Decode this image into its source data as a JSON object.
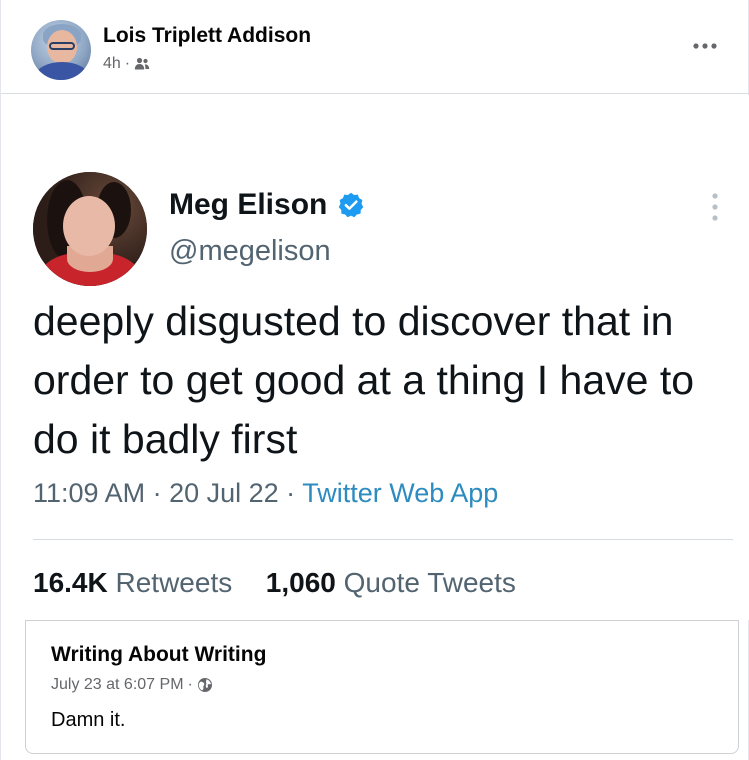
{
  "post": {
    "author": "Lois Triplett Addison",
    "time": "4h",
    "separator": "·",
    "audience_icon": "friends-icon",
    "more_icon": "more-horizontal-icon"
  },
  "tweet": {
    "name": "Meg Elison",
    "verified_icon": "verified-badge-icon",
    "handle": "@megelison",
    "text": "deeply disgusted to discover that in order to get good at a thing I have to do it badly first",
    "time": "11:09 AM",
    "sep1": " · ",
    "date": "20 Jul 22",
    "sep2": " · ",
    "source": "Twitter Web App",
    "retweets_count": "16.4K",
    "retweets_label": "Retweets",
    "quotes_count": "1,060",
    "quotes_label": "Quote Tweets",
    "more_icon": "more-vertical-icon"
  },
  "shared_from": {
    "page_name": "Writing About Writing",
    "date": "July 23 at 6:07 PM",
    "separator": "·",
    "audience_icon": "globe-icon",
    "caption": "Damn it."
  },
  "colors": {
    "fb_text": "#050505",
    "fb_secondary": "#65676b",
    "twitter_text": "#0f1419",
    "twitter_secondary": "#536471",
    "twitter_link": "#2e8bc0",
    "verified_blue": "#1d9bf0"
  }
}
